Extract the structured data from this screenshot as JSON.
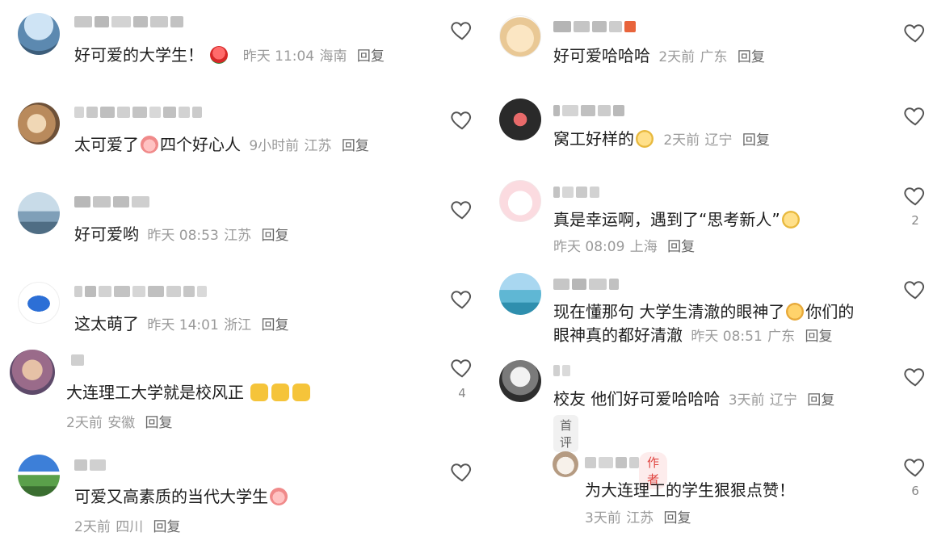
{
  "colors": {
    "meta": "#9a9a9a",
    "reply": "#666666",
    "author_badge": "#e0443f"
  },
  "left": [
    {
      "text": "好可爱的大学生！",
      "emoji": "rose",
      "time": "昨天 11:04",
      "location": "海南",
      "reply": "回复",
      "likes": ""
    },
    {
      "text_a": "太可爱了",
      "emoji": "pig",
      "text_b": "四个好心人",
      "time": "9小时前",
      "location": "江苏",
      "reply": "回复",
      "likes": ""
    },
    {
      "text": "好可爱哟",
      "time": "昨天 08:53",
      "location": "江苏",
      "reply": "回复",
      "likes": ""
    },
    {
      "text": "这太萌了",
      "time": "昨天 14:01",
      "location": "浙江",
      "reply": "回复",
      "likes": ""
    },
    {
      "text": "大连理工大学就是校风正",
      "emoji": "thumbs-up x3",
      "time": "2天前",
      "location": "安徽",
      "reply": "回复",
      "likes": "4"
    },
    {
      "text": "可爱又高素质的当代大学生",
      "emoji": "pig",
      "time": "2天前",
      "location": "四川",
      "reply": "回复",
      "likes": ""
    }
  ],
  "right": [
    {
      "text": "好可爱哈哈哈",
      "time": "2天前",
      "location": "广东",
      "reply": "回复",
      "likes": ""
    },
    {
      "text": "窝工好样的",
      "emoji": "grin",
      "time": "2天前",
      "location": "辽宁",
      "reply": "回复",
      "likes": ""
    },
    {
      "text": "真是幸运啊，遇到了“思考新人”",
      "emoji": "grin",
      "time": "昨天 08:09",
      "location": "上海",
      "reply": "回复",
      "likes": "2"
    },
    {
      "text_a": "现在懂那句 大学生清澈的眼神了",
      "emoji": "cry",
      "text_b": "你们的",
      "text_c": "眼神真的都好清澈",
      "time": "昨天 08:51",
      "location": "广东",
      "reply": "回复",
      "likes": ""
    },
    {
      "text": "校友 他们好可爱哈哈哈",
      "time": "3天前",
      "location": "辽宁",
      "reply": "回复",
      "likes": "",
      "tag": "首评"
    },
    {
      "text": "为大连理工的学生狠狠点赞！",
      "time": "3天前",
      "location": "江苏",
      "reply": "回复",
      "likes": "6",
      "author_tag": "作者"
    }
  ]
}
